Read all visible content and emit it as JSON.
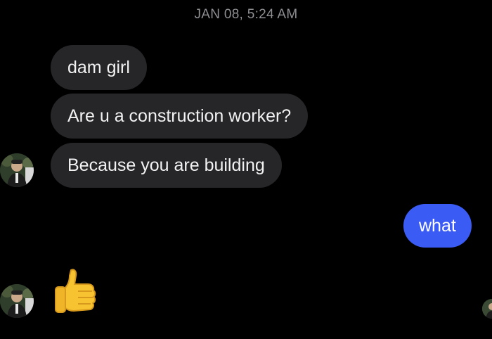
{
  "conversation": {
    "timestamp": "JAN 08, 5:24 AM",
    "messages": [
      {
        "direction": "received",
        "text": "dam girl"
      },
      {
        "direction": "received",
        "text": "Are u a construction worker?"
      },
      {
        "direction": "received",
        "text": "Because you are building"
      },
      {
        "direction": "sent",
        "text": "what"
      },
      {
        "direction": "received",
        "emoji": "thumbs-up"
      }
    ]
  },
  "colors": {
    "background": "#000000",
    "received_bubble": "#262629",
    "sent_bubble": "#3a5cf5",
    "timestamp_text": "#8e8e93"
  },
  "icons": {
    "reaction": "thumbs-up-emoji",
    "sender_avatar": "avatar-photo",
    "seen_indicator": "read-receipt-avatar"
  }
}
